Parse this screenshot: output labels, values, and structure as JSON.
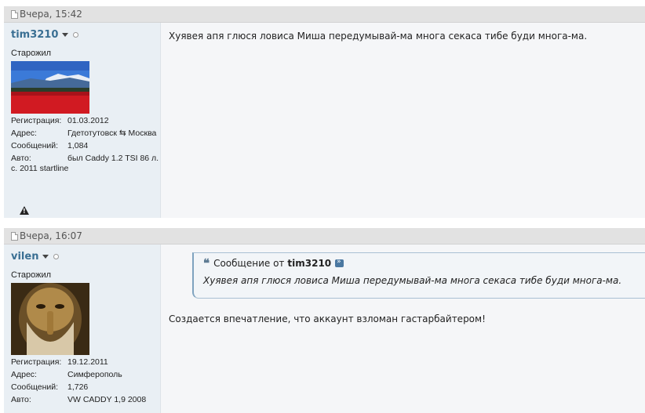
{
  "posts": [
    {
      "date": "Вчера, 15:42",
      "username": "tim3210",
      "rank": "Старожил",
      "avatar": "avatar-red-tulip-field",
      "reg_label": "Регистрация:",
      "reg_value": "01.03.2012",
      "addr_label": "Адрес:",
      "addr_value": "Гдетотутовск ⇆ Москва",
      "msgs_label": "Сообщений:",
      "msgs_value": "1,084",
      "auto_label": "Авто:",
      "auto_value": "был Caddy 1.2 TSI 86 л. с. 2011 startline",
      "message": "Хуявея апя глюся ловиса Миша передумывай-ма многа секаса тибе буди многа-ма."
    },
    {
      "date": "Вчера, 16:07",
      "username": "vilen",
      "rank": "Старожил",
      "avatar": "avatar-bearded-man-shush",
      "reg_label": "Регистрация:",
      "reg_value": "19.12.2011",
      "addr_label": "Адрес:",
      "addr_value": "Симферополь",
      "msgs_label": "Сообщений:",
      "msgs_value": "1,726",
      "auto_label": "Авто:",
      "auto_value": "VW CADDY 1,9 2008",
      "quote_prefix": "Сообщение от",
      "quote_author": "tim3210",
      "quote_text": "Хуявея апя глюся ловиса Миша передумывай-ма многа секаса тибе буди многа-ма.",
      "message": "Создается впечатление, что аккаунт взломан гастарбайтером!"
    }
  ],
  "colors": {
    "username": "#3a6f93",
    "header_bg": "#e2e2e2",
    "userinfo_bg": "#e9eff4"
  }
}
